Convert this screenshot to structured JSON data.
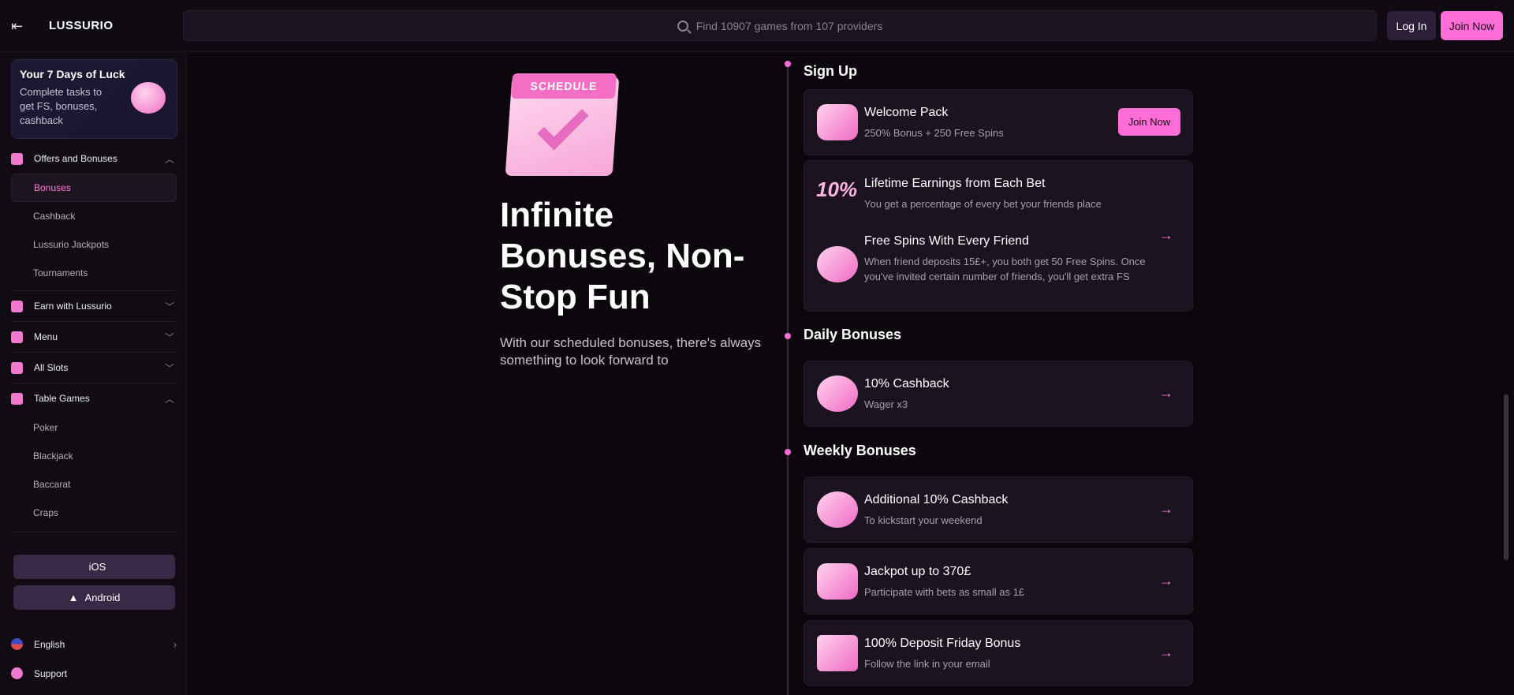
{
  "header": {
    "logo": "LUSSURIO",
    "search_placeholder": "Find 10907 games from 107 providers",
    "login_label": "Log In",
    "join_label": "Join Now"
  },
  "sidebar": {
    "luck_card": {
      "title": "Your 7 Days of Luck",
      "description": "Complete tasks to get FS, bonuses, cashback"
    },
    "sections": [
      {
        "label": "Offers and Bonuses",
        "expanded": true,
        "icon": "gift-icon",
        "items": [
          "Bonuses",
          "Cashback",
          "Lussurio Jackpots",
          "Tournaments"
        ],
        "active": "Bonuses"
      },
      {
        "label": "Earn with Lussurio",
        "expanded": false,
        "icon": "coins-icon"
      },
      {
        "label": "Menu",
        "expanded": false,
        "icon": "menu-search-icon"
      },
      {
        "label": "All Slots",
        "expanded": false,
        "icon": "grid-icon"
      },
      {
        "label": "Table Games",
        "expanded": true,
        "icon": "dice-icon",
        "items": [
          "Poker",
          "Blackjack",
          "Baccarat",
          "Craps"
        ]
      }
    ],
    "app_buttons": [
      "iOS",
      "Android"
    ],
    "language": "English",
    "support": "Support"
  },
  "hero": {
    "calendar_label": "SCHEDULE",
    "title": "Infinite Bonuses, Non-Stop Fun",
    "subtitle": "With our scheduled bonuses, there's always something to look forward to"
  },
  "timeline": {
    "sign_up": {
      "title": "Sign Up",
      "welcome": {
        "title": "Welcome Pack",
        "desc": "250% Bonus + 250 Free Spins",
        "button": "Join Now"
      },
      "referral": {
        "badge": "10%",
        "earn_title": "Lifetime Earnings from Each Bet",
        "earn_desc": "You get a percentage of every bet your friends place",
        "spins_title": "Free Spins With Every Friend",
        "spins_desc": "When friend deposits 15£+, you both get 50 Free Spins. Once you've invited certain number of friends, you'll get extra FS"
      }
    },
    "daily": {
      "title": "Daily Bonuses",
      "cashback": {
        "title": "10% Cashback",
        "desc": "Wager x3"
      }
    },
    "weekly": {
      "title": "Weekly Bonuses",
      "items": [
        {
          "title": "Additional 10% Cashback",
          "desc": "To kickstart your weekend"
        },
        {
          "title": "Jackpot up to 370£",
          "desc": "Participate with bets as small as 1£"
        },
        {
          "title": "100% Deposit Friday Bonus",
          "desc": "Follow the link in your email"
        }
      ]
    }
  },
  "colors": {
    "accent": "#ff6ed6",
    "background": "#0c070d",
    "card": "#1b1420"
  }
}
